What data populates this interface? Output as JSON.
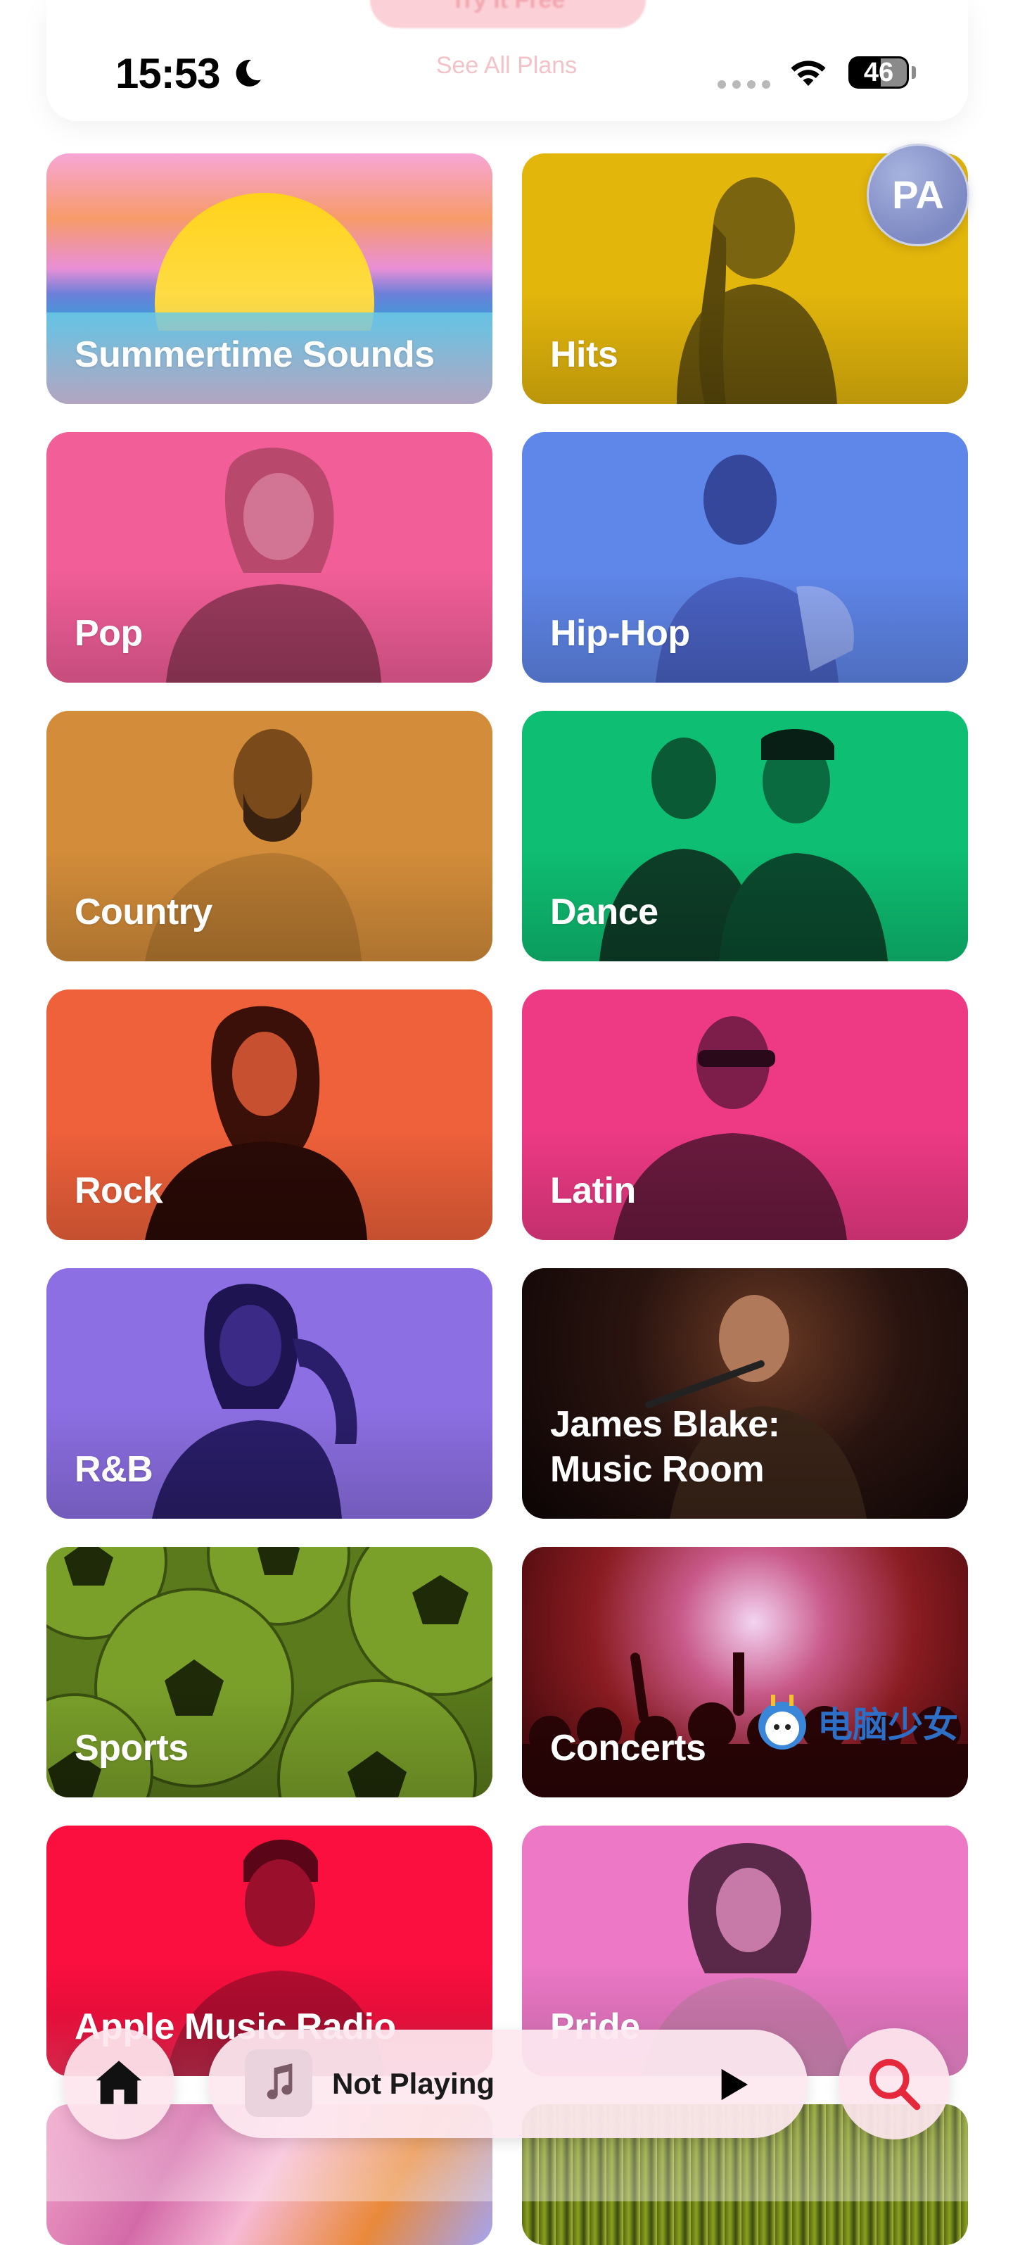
{
  "status_bar": {
    "time": "15:53",
    "battery_level": "46",
    "focus_icon": "moon-icon",
    "wifi_icon": "wifi-icon"
  },
  "promo": {
    "cta_label": "Try It Free",
    "plans_link": "See All Plans"
  },
  "account": {
    "initials": "PA"
  },
  "categories": [
    {
      "label": "Summertime Sounds",
      "color": "#f7a7c2"
    },
    {
      "label": "Hits",
      "color": "#e3b60c"
    },
    {
      "label": "Pop",
      "color": "#f15e98"
    },
    {
      "label": "Hip-Hop",
      "color": "#5f86e9"
    },
    {
      "label": "Country",
      "color": "#d38d3a"
    },
    {
      "label": "Dance",
      "color": "#0ebe72"
    },
    {
      "label": "Rock",
      "color": "#ef613a"
    },
    {
      "label": "Latin",
      "color": "#ee3a85"
    },
    {
      "label": "R&B",
      "color": "#8c6fe3"
    },
    {
      "label": "James Blake:\nMusic Room",
      "color": "#1b0d0a"
    },
    {
      "label": "Sports",
      "color": "#5a7a1c"
    },
    {
      "label": "Concerts",
      "color": "#7a1718"
    },
    {
      "label": "Apple Music Radio",
      "color": "#fa0f3f"
    },
    {
      "label": "Pride",
      "color": "#ec78c6"
    }
  ],
  "mini_player": {
    "title": "Not Playing",
    "artwork_icon": "music-note-icon",
    "play_icon": "play-icon"
  },
  "tab_bar": {
    "home_icon": "home-icon",
    "search_icon": "search-icon"
  },
  "watermark_text": "电脑少女"
}
